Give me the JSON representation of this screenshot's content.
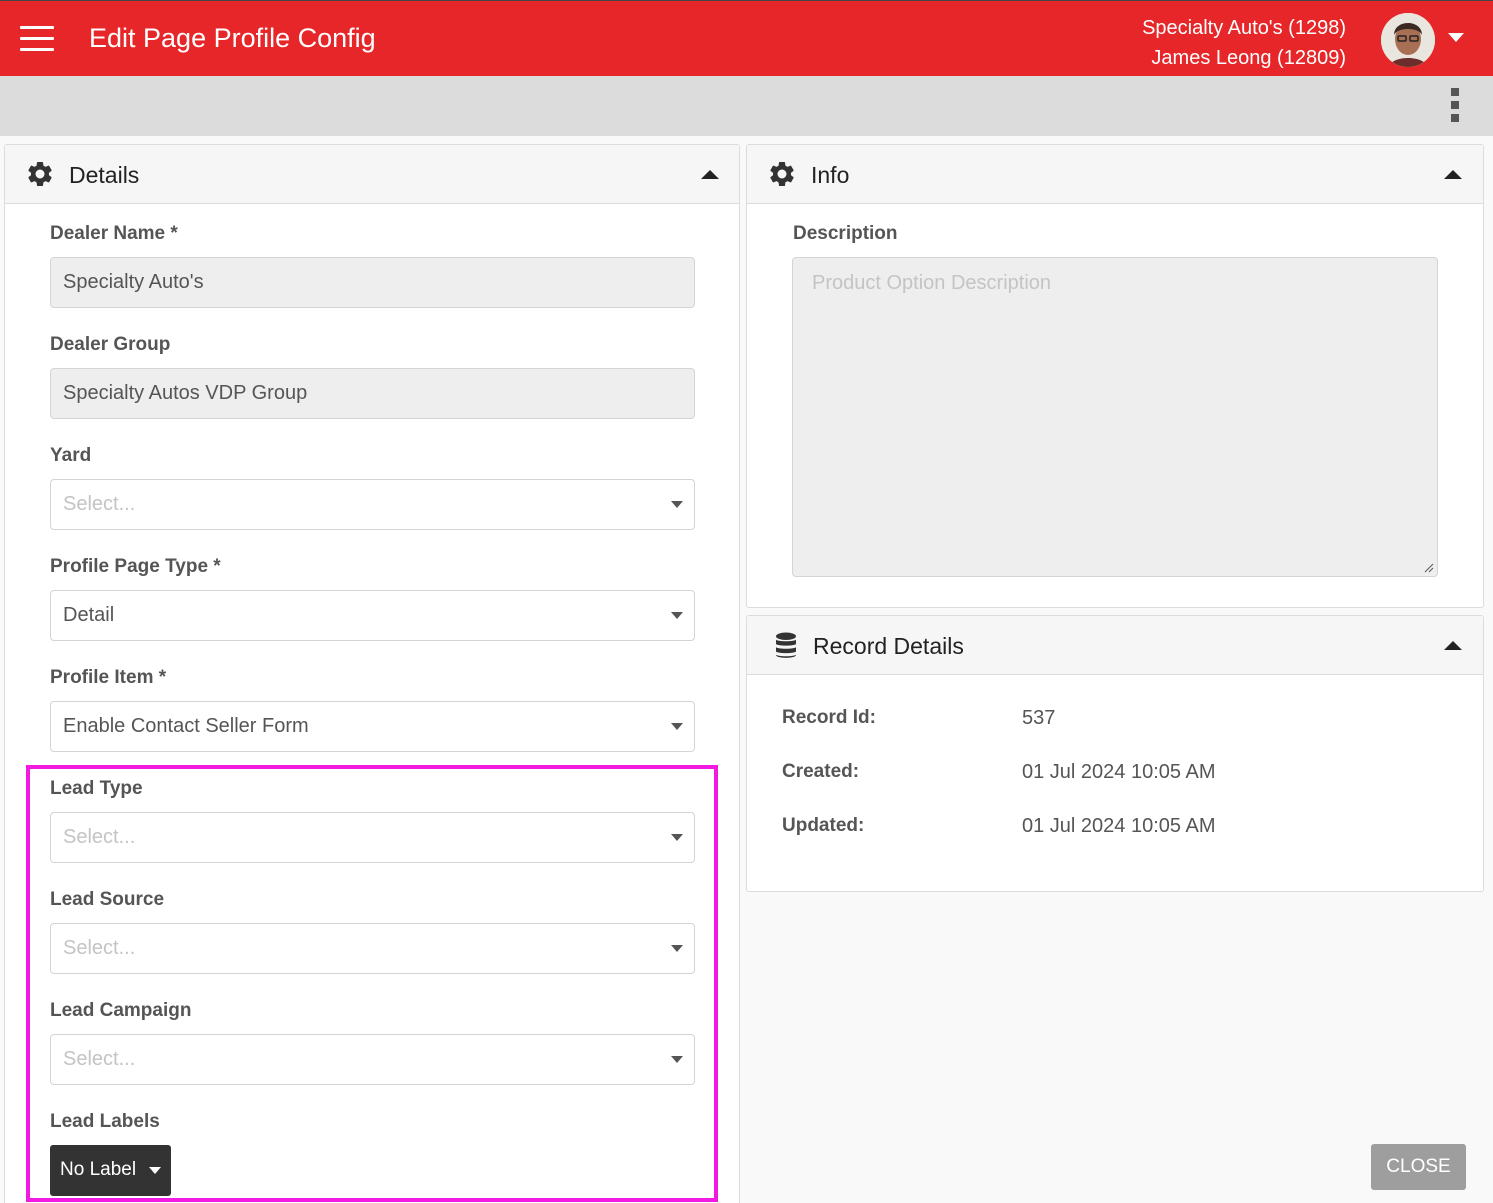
{
  "header": {
    "title": "Edit Page Profile Config",
    "dealer": "Specialty Auto's (1298)",
    "user": "James Leong (12809)"
  },
  "details": {
    "title": "Details",
    "dealer_name": {
      "label": "Dealer Name *",
      "value": "Specialty Auto's"
    },
    "dealer_group": {
      "label": "Dealer Group",
      "value": "Specialty Autos VDP Group"
    },
    "yard": {
      "label": "Yard",
      "placeholder": "Select..."
    },
    "profile_page_type": {
      "label": "Profile Page Type *",
      "value": "Detail"
    },
    "profile_item": {
      "label": "Profile Item *",
      "value": "Enable Contact Seller Form"
    },
    "lead_type": {
      "label": "Lead Type",
      "placeholder": "Select..."
    },
    "lead_source": {
      "label": "Lead Source",
      "placeholder": "Select..."
    },
    "lead_campaign": {
      "label": "Lead Campaign",
      "placeholder": "Select..."
    },
    "lead_labels": {
      "label": "Lead Labels",
      "button": "No Label"
    }
  },
  "info": {
    "title": "Info",
    "description_label": "Description",
    "description_placeholder": "Product Option Description"
  },
  "record_details": {
    "title": "Record Details",
    "record_id_label": "Record Id:",
    "record_id": "537",
    "created_label": "Created:",
    "created": "01 Jul 2024 10:05 AM",
    "updated_label": "Updated:",
    "updated": "01 Jul 2024 10:05 AM"
  },
  "footer": {
    "close_label": "CLOSE"
  },
  "colors": {
    "brand": "#e62628",
    "highlight": "#f21ae0"
  },
  "icons": [
    "menu-icon",
    "avatar",
    "chevron-down-icon",
    "kebab-menu-icon",
    "gear-icon",
    "chevron-up-icon",
    "database-icon",
    "dropdown-caret-icon"
  ]
}
